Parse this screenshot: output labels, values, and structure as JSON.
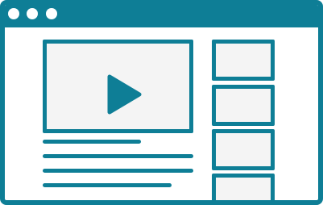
{
  "colors": {
    "accent": "#0E7E96",
    "dot": "#ffffff",
    "content_bg": "#ffffff",
    "placeholder": "#F4F4F4"
  },
  "window": {
    "controls": [
      "window-dot-icon",
      "window-dot-icon",
      "window-dot-icon"
    ]
  },
  "main": {
    "player_icon": "play-icon",
    "description_line_count": 4
  },
  "sidebar": {
    "thumbnail_count": 4
  }
}
